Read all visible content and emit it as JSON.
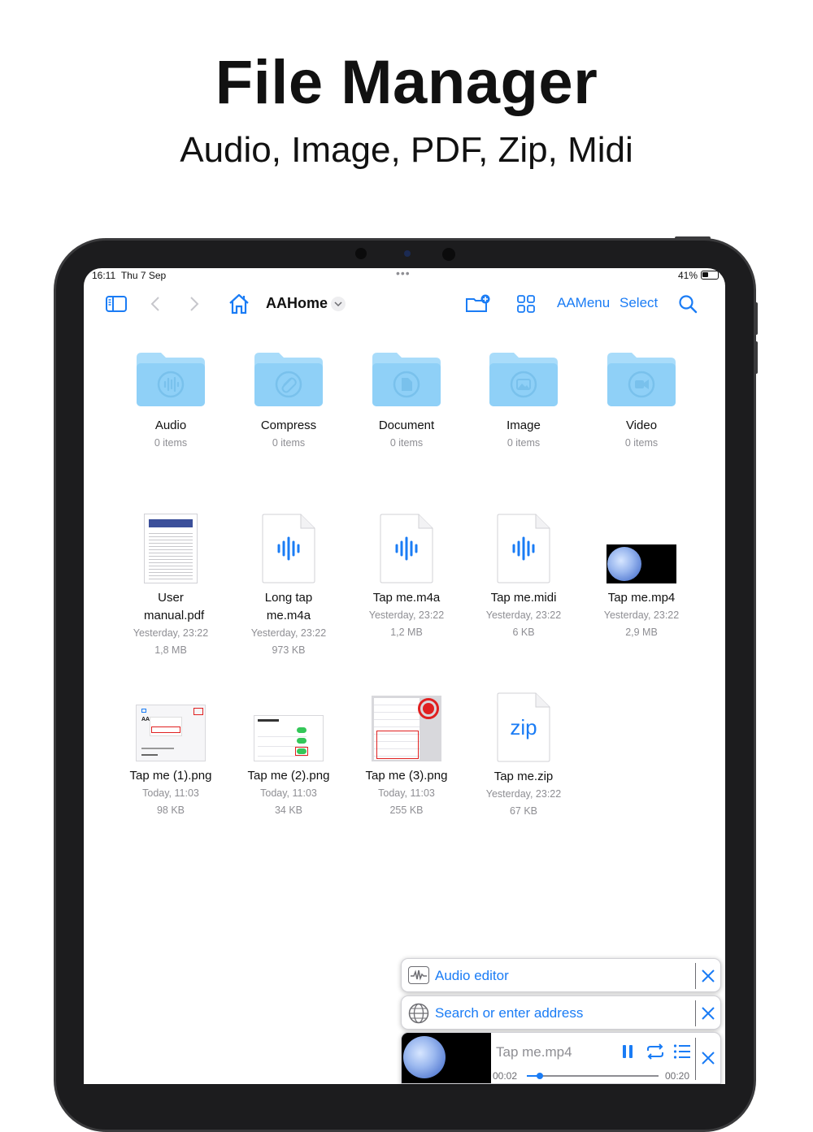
{
  "promo": {
    "title": "File Manager",
    "subtitle": "Audio, Image, PDF, Zip, Midi"
  },
  "status_bar": {
    "time": "16:11",
    "date": "Thu 7 Sep",
    "battery": "41%"
  },
  "toolbar": {
    "sidebar_icon": "sidebar-icon",
    "back_icon": "chevron-left-icon",
    "forward_icon": "chevron-right-icon",
    "home_icon": "house-icon",
    "location": "AAHome",
    "new_folder_icon": "folder-plus-icon",
    "grid_icon": "grid-view-icon",
    "menu_label": "AAMenu",
    "select_label": "Select",
    "search_icon": "magnifier-icon"
  },
  "folders": [
    {
      "name": "Audio",
      "meta": "0 items",
      "icon": "waveform-icon"
    },
    {
      "name": "Compress",
      "meta": "0 items",
      "icon": "paperclip-icon"
    },
    {
      "name": "Document",
      "meta": "0 items",
      "icon": "document-icon"
    },
    {
      "name": "Image",
      "meta": "0 items",
      "icon": "photo-icon"
    },
    {
      "name": "Video",
      "meta": "0 items",
      "icon": "video-camera-icon"
    }
  ],
  "files_row1": [
    {
      "name": "User manual.pdf",
      "date": "Yesterday, 23:22",
      "size": "1,8 MB"
    },
    {
      "name": "Long tap me.m4a",
      "date": "Yesterday, 23:22",
      "size": "973 KB"
    },
    {
      "name": "Tap me.m4a",
      "date": "Yesterday, 23:22",
      "size": "1,2 MB"
    },
    {
      "name": "Tap me.midi",
      "date": "Yesterday, 23:22",
      "size": "6 KB"
    },
    {
      "name": "Tap me.mp4",
      "date": "Yesterday, 23:22",
      "size": "2,9 MB"
    }
  ],
  "files_row2": [
    {
      "name": "Tap me (1).png",
      "date": "Today, 11:03",
      "size": "98 KB"
    },
    {
      "name": "Tap me (2).png",
      "date": "Today, 11:03",
      "size": "34 KB"
    },
    {
      "name": "Tap me (3).png",
      "date": "Today, 11:03",
      "size": "255 KB"
    },
    {
      "name": "Tap me.zip",
      "date": "Yesterday, 23:22",
      "size": "67 KB"
    }
  ],
  "zip_glyph": "zip",
  "panels": {
    "audio_editor": "Audio editor",
    "browser_placeholder": "Search or enter address"
  },
  "player": {
    "title": "Tap me.mp4",
    "elapsed": "00:02",
    "duration": "00:20",
    "progress": 0.1
  },
  "colors": {
    "accent": "#1a7cf5",
    "folder": "#8fd0f7",
    "folder_tab": "#a9dcfa"
  }
}
